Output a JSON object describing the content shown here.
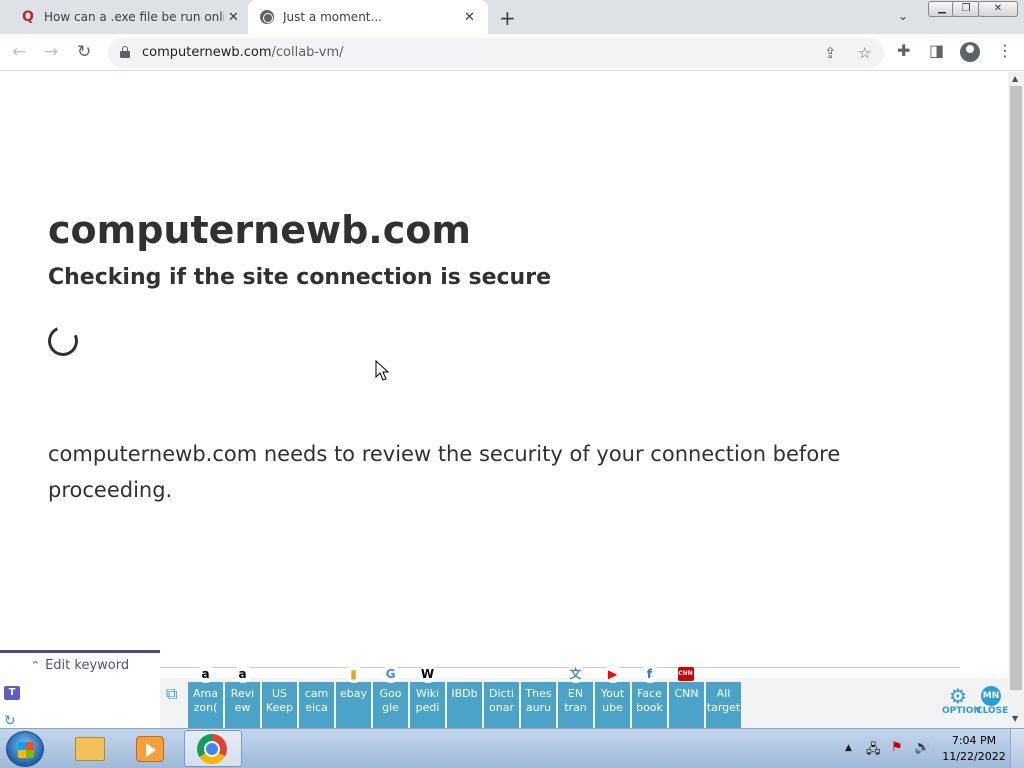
{
  "tabs": [
    {
      "title": "How can a .exe file be run online",
      "icon": "quora-icon",
      "active": false
    },
    {
      "title": "Just a moment...",
      "icon": "globe-icon",
      "active": true
    }
  ],
  "address": {
    "domain": "computernewb.com",
    "path": "/collab-vm/"
  },
  "page": {
    "site_title": "computernewb.com",
    "subtitle": "Checking if the site connection is secure",
    "review_text": "computernewb.com needs to review the security of your connection before proceeding."
  },
  "keyword_toolbar": {
    "edit_label": "Edit keyword",
    "buttons": [
      {
        "label": "Ama\nzon(",
        "icon": "amazon-icon"
      },
      {
        "label": "Revi\new",
        "icon": "amazon-icon"
      },
      {
        "label": "US\nKeep",
        "icon": ""
      },
      {
        "label": "cam\nelca",
        "icon": ""
      },
      {
        "label": "ebay",
        "icon": "shopping-bag-icon"
      },
      {
        "label": "Goo\ngle",
        "icon": "google-icon"
      },
      {
        "label": "Wiki\npedi",
        "icon": "wikipedia-icon"
      },
      {
        "label": "IBDb",
        "icon": ""
      },
      {
        "label": "Dicti\nonar",
        "icon": ""
      },
      {
        "label": "Thes\nauru",
        "icon": ""
      },
      {
        "label": "EN\ntran",
        "icon": "translate-icon"
      },
      {
        "label": "Yout\nube",
        "icon": "youtube-icon"
      },
      {
        "label": "Face\nbook",
        "icon": "facebook-icon"
      },
      {
        "label": "CNN",
        "icon": "cnn-icon"
      },
      {
        "label": "All\ntarget",
        "icon": ""
      }
    ],
    "option_label": "OPTION",
    "close_label": "CLOSE"
  },
  "taskbar": {
    "time": "7:04 PM",
    "date": "11/22/2022"
  },
  "colors": {
    "keyword_button": "#4ba3c7",
    "keyword_accent": "#2a9fd6",
    "edit_keyword_border": "#4b4e8a",
    "heading_text": "#313131"
  }
}
